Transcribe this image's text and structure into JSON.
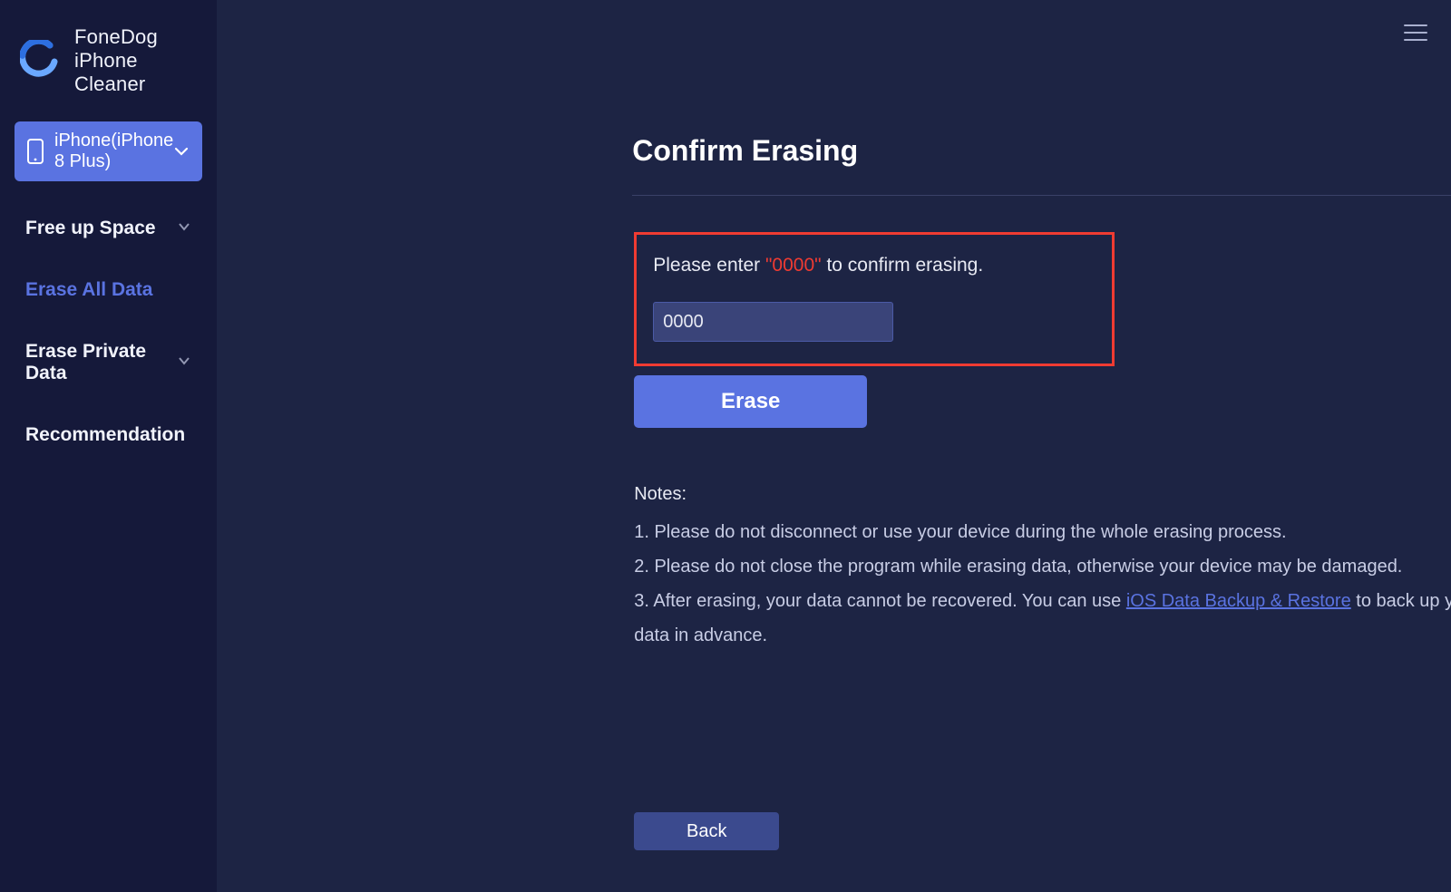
{
  "app": {
    "title": "FoneDog iPhone Cleaner"
  },
  "device": {
    "label": "iPhone(iPhone 8 Plus)"
  },
  "sidebar": {
    "items": [
      {
        "label": "Free up Space",
        "active": false,
        "expandable": true
      },
      {
        "label": "Erase All Data",
        "active": true,
        "expandable": false
      },
      {
        "label": "Erase Private Data",
        "active": false,
        "expandable": true
      },
      {
        "label": "Recommendation",
        "active": false,
        "expandable": false
      }
    ]
  },
  "main": {
    "title": "Confirm Erasing",
    "prompt_before": "Please enter ",
    "prompt_code": "\"0000\"",
    "prompt_after": " to confirm erasing.",
    "input_value": "0000",
    "erase_label": "Erase",
    "back_label": "Back",
    "notes_header": "Notes:",
    "note1": "1. Please do not disconnect or use your device during the whole erasing process.",
    "note2": "2. Please do not close the program while erasing data, otherwise your device may be damaged.",
    "note3_before": "3. After erasing, your data cannot be recovered. You can use ",
    "note3_link": "iOS Data Backup & Restore",
    "note3_after": " to back up your important data in advance."
  }
}
